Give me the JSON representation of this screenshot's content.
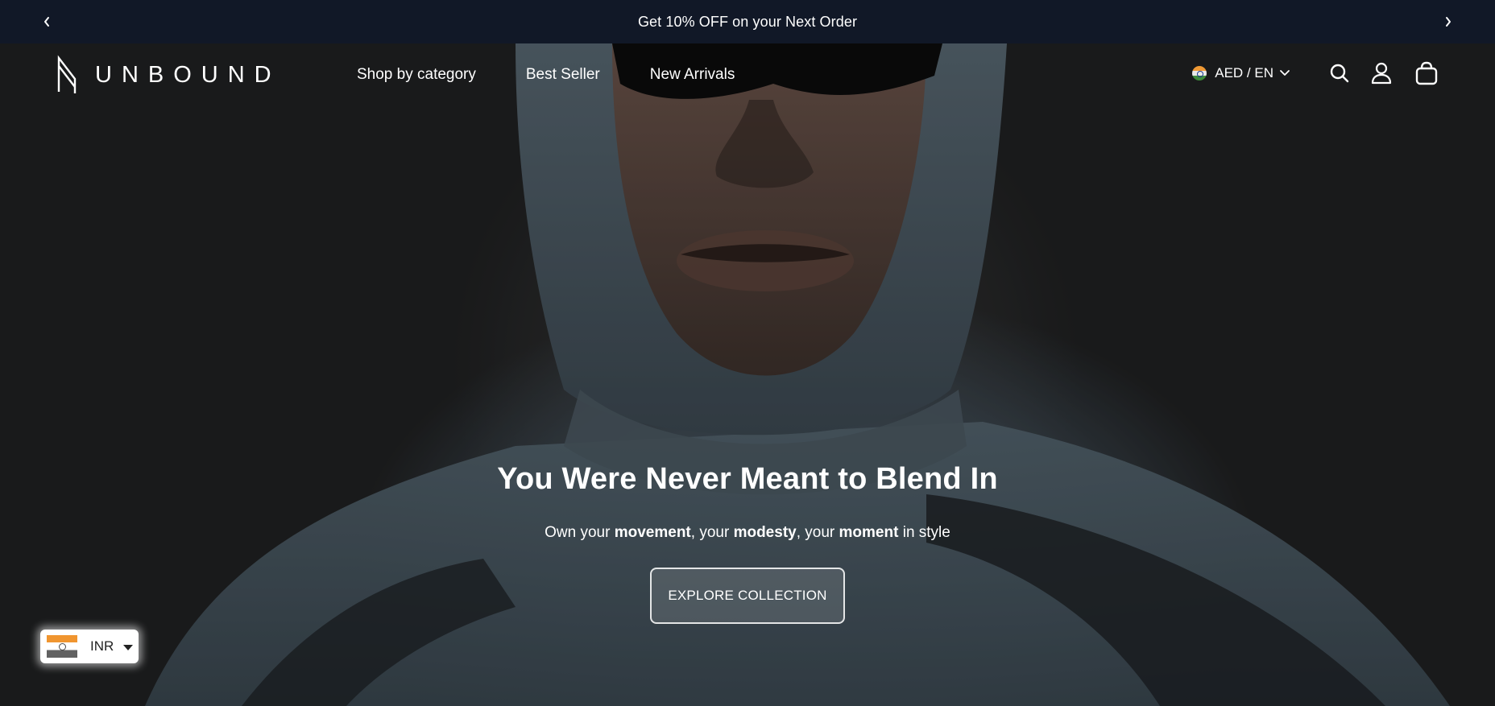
{
  "announcement": {
    "text": "Get 10% OFF on your Next Order",
    "prev_icon": "chevron-left-icon",
    "next_icon": "chevron-right-icon"
  },
  "header": {
    "logo_text": "UNBOUND",
    "nav": [
      {
        "label": "Shop by category"
      },
      {
        "label": "Best Seller"
      },
      {
        "label": "New Arrivals"
      }
    ],
    "locale_label": "AED / EN",
    "icons": [
      "search-icon",
      "user-icon",
      "bag-icon"
    ]
  },
  "hero": {
    "title": "You Were Never Meant to Blend In",
    "subtitle_parts": {
      "p1": "Own your ",
      "b1": "movement",
      "p2": ", your ",
      "b2": "modesty",
      "p3": ", your ",
      "b3": "moment",
      "p4": " in style"
    },
    "cta_label": "EXPLORE COLLECTION"
  },
  "currency_widget": {
    "code": "INR"
  },
  "colors": {
    "announcement_bg": "#111827",
    "text": "#ffffff",
    "widget_bg": "#ffffff"
  }
}
